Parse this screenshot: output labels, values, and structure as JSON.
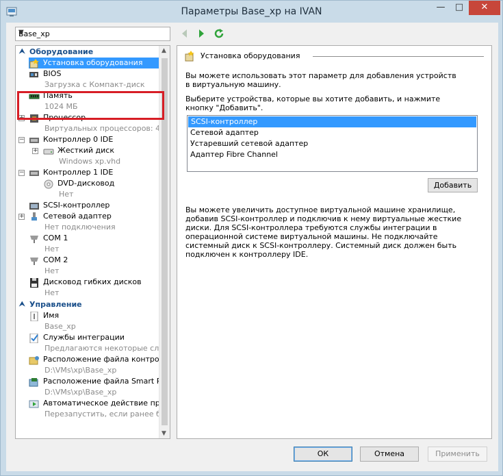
{
  "window": {
    "title": "Параметры Base_xp на IVAN",
    "min": "—",
    "max": "□",
    "close": "✕"
  },
  "vm_select": {
    "value": "Base_xp"
  },
  "tree": {
    "hardware_section": "Оборудование",
    "add_hardware": "Установка оборудования",
    "bios": {
      "label": "BIOS",
      "detail": "Загрузка с Компакт-диск"
    },
    "memory": {
      "label": "Память",
      "detail": "1024 МБ"
    },
    "processor": {
      "label": "Процессор",
      "detail": "Виртуальных процессоров: 4"
    },
    "ide0": {
      "label": "Контроллер 0 IDE"
    },
    "hdd": {
      "label": "Жесткий диск",
      "detail": "Windows xp.vhd"
    },
    "ide1": {
      "label": "Контроллер 1 IDE"
    },
    "dvd": {
      "label": "DVD-дисковод",
      "detail": "Нет"
    },
    "scsi": {
      "label": "SCSI-контроллер"
    },
    "nic": {
      "label": "Сетевой адаптер",
      "detail": "Нет подключения"
    },
    "com1": {
      "label": "COM 1",
      "detail": "Нет"
    },
    "com2": {
      "label": "COM 2",
      "detail": "Нет"
    },
    "floppy": {
      "label": "Дисковод гибких дисков",
      "detail": "Нет"
    },
    "management_section": "Управление",
    "name": {
      "label": "Имя",
      "detail": "Base_xp"
    },
    "integration": {
      "label": "Службы интеграции",
      "detail": "Предлагаются некоторые сл..."
    },
    "checkpoint_location": {
      "label": "Расположение файла контрол...",
      "detail": "D:\\VMs\\xp\\Base_xp"
    },
    "smartpaging_location": {
      "label": "Расположение файла Smart P...",
      "detail": "D:\\VMs\\xp\\Base_xp"
    },
    "auto_action": {
      "label": "Автоматическое действие пр...",
      "detail": "Перезапустить, если ранее б..."
    }
  },
  "panel": {
    "title": "Установка оборудования",
    "intro": "Вы можете использовать этот параметр для добавления устройств в виртуальную машину.",
    "instruction": "Выберите устройства, которые вы хотите добавить, и нажмите кнопку \"Добавить\".",
    "devices": [
      "SCSI-контроллер",
      "Сетевой адаптер",
      "Устаревший сетевой адаптер",
      "Адаптер Fibre Channel"
    ],
    "add_button": "Добавить",
    "info": "Вы можете увеличить доступное виртуальной машине хранилище, добавив SCSI-контроллер и подключив к нему виртуальные жесткие диски. Для SCSI-контроллера требуются службы интеграции в операционной системе виртуальной машины. Не подключайте системный диск к SCSI-контроллеру. Системный диск должен быть подключен к контроллеру IDE."
  },
  "buttons": {
    "ok": "ОК",
    "cancel": "Отмена",
    "apply": "Применить"
  },
  "colors": {
    "selection": "#3399ff",
    "section": "#1a4f8a",
    "highlight": "#d71d25",
    "close": "#c7463a"
  }
}
